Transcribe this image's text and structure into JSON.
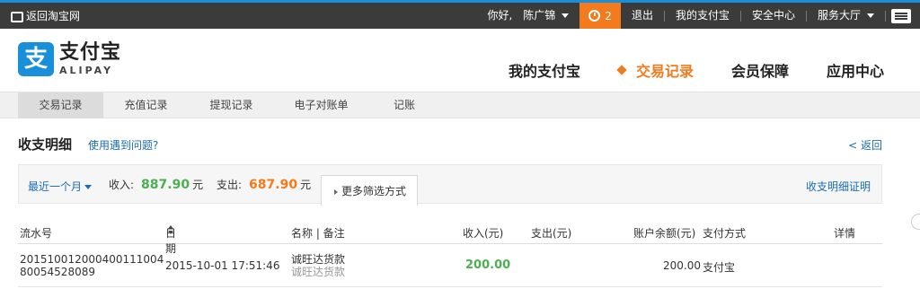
{
  "topbar": {
    "back_label": "返回淘宝网",
    "greeting": "你好,",
    "user": "陈广锦",
    "alarm_count": "2",
    "logout": "退出",
    "my_alipay": "我的支付宝",
    "security": "安全中心",
    "service": "服务大厅",
    "accent_color": "#f37b1d",
    "icons": [
      "back-icon",
      "alarm-clock-icon",
      "menu-list-icon"
    ]
  },
  "logo": {
    "mark": "支",
    "cn": "支付宝",
    "en": "ALIPAY",
    "color": "#1a8fd9"
  },
  "mainnav": {
    "items": [
      {
        "label": "我的支付宝"
      },
      {
        "label": "交易记录",
        "active": true
      },
      {
        "label": "会员保障"
      },
      {
        "label": "应用中心"
      }
    ]
  },
  "subnav": {
    "items": [
      {
        "label": "交易记录",
        "active": true
      },
      {
        "label": "充值记录"
      },
      {
        "label": "提现记录"
      },
      {
        "label": "电子对账单"
      },
      {
        "label": "记账"
      }
    ]
  },
  "page": {
    "title": "收支明细",
    "help_link": "使用遇到问题?",
    "back_link": "< 返回"
  },
  "summary": {
    "range": "最近一个月",
    "income_label": "收入:",
    "income_value": "887.90",
    "income_unit": "元",
    "expense_label": "支出:",
    "expense_value": "687.90",
    "expense_unit": "元",
    "more_filter": "更多筛选方式",
    "certificate": "收支明细证明"
  },
  "table": {
    "headers": {
      "serial": "流水号",
      "date": "日期",
      "name": "名称 | 备注",
      "income": "收入(元)",
      "expense": "支出(元)",
      "balance": "账户余额(元)",
      "method": "支付方式",
      "detail": "详情"
    },
    "rows": [
      {
        "serial_line1": "20151001200040011100 4",
        "serial_line2": "80054528089",
        "date": "2015-10-01 17:51:46",
        "name": "诚旺达货款",
        "note": "诚旺达货款",
        "income": "200.00",
        "expense": "",
        "balance": "200.00",
        "method": "支付宝",
        "detail": ""
      }
    ]
  }
}
